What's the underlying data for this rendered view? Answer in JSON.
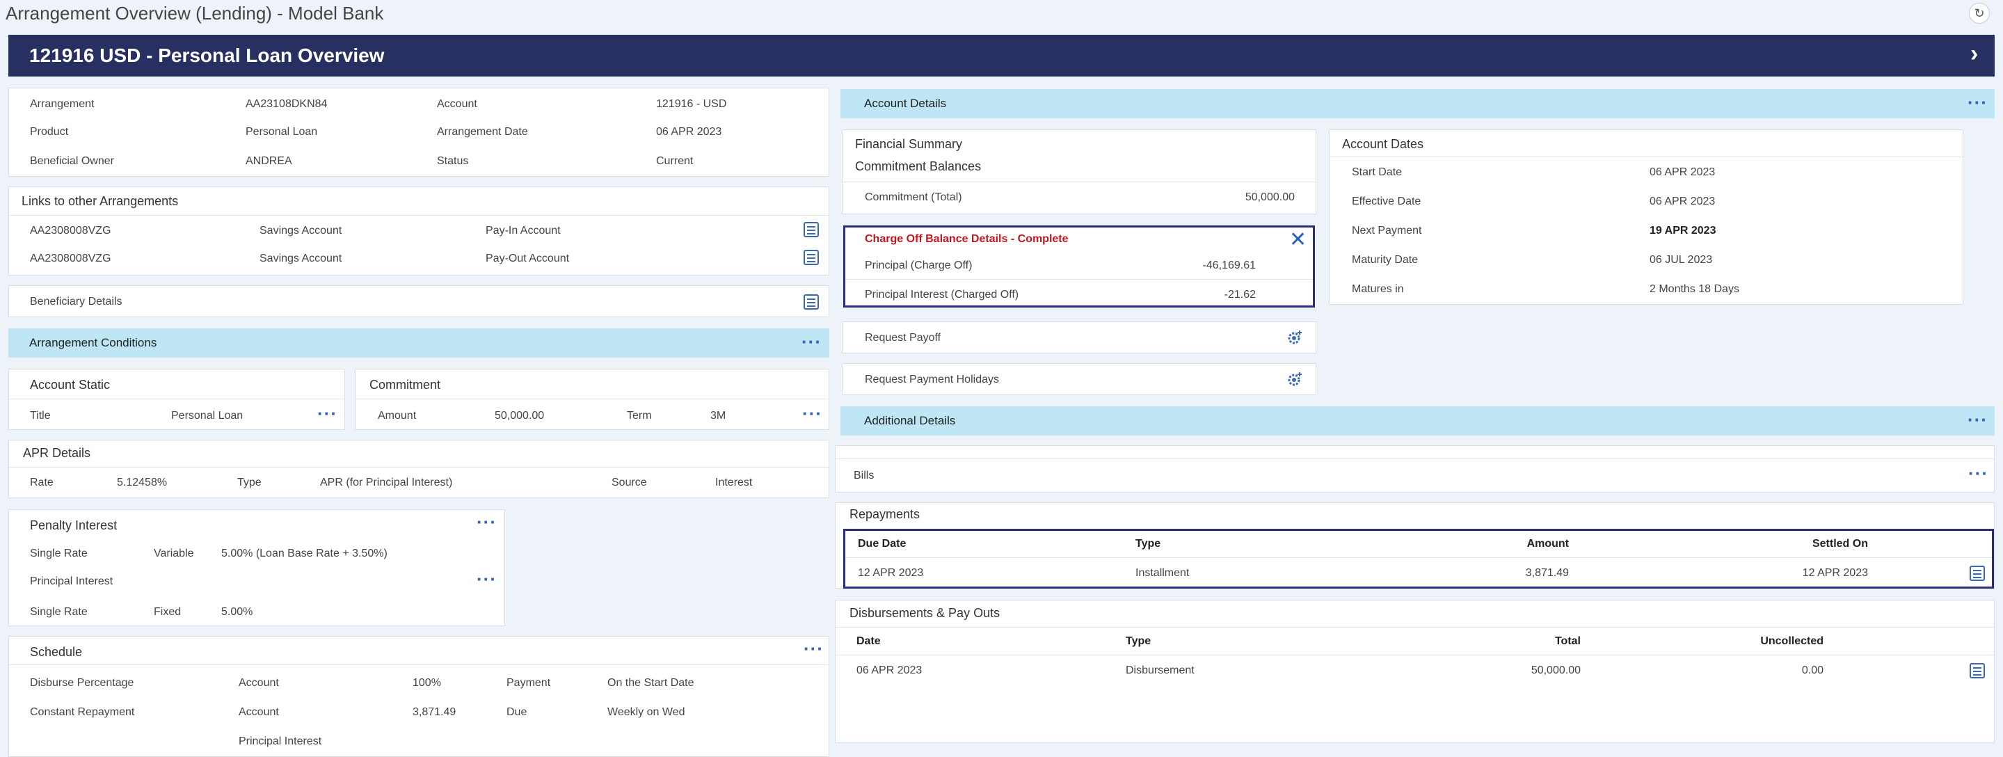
{
  "window": {
    "title": "Arrangement Overview (Lending) - Model Bank"
  },
  "banner": {
    "title": "121916 USD - Personal Loan Overview"
  },
  "arrangement": {
    "arrangement_label": "Arrangement",
    "arrangement_value": "AA23108DKN84",
    "account_label": "Account",
    "account_value": "121916 - USD",
    "product_label": "Product",
    "product_value": "Personal Loan",
    "arr_date_label": "Arrangement Date",
    "arr_date_value": "06 APR 2023",
    "owner_label": "Beneficial Owner",
    "owner_value": "ANDREA",
    "status_label": "Status",
    "status_value": "Current"
  },
  "links": {
    "title": "Links to other Arrangements",
    "rows": [
      {
        "id": "AA2308008VZG",
        "type": "Savings Account",
        "role": "Pay-In Account"
      },
      {
        "id": "AA2308008VZG",
        "type": "Savings Account",
        "role": "Pay-Out Account"
      }
    ]
  },
  "beneficiary": {
    "title": "Beneficiary Details"
  },
  "conditions": {
    "title": "Arrangement Conditions"
  },
  "account_static": {
    "title": "Account Static",
    "label": "Title",
    "value": "Personal Loan"
  },
  "commitment": {
    "title": "Commitment",
    "amount_label": "Amount",
    "amount_value": "50,000.00",
    "term_label": "Term",
    "term_value": "3M"
  },
  "apr": {
    "title": "APR Details",
    "rate_label": "Rate",
    "rate_value": "5.12458%",
    "type_label": "Type",
    "type_value": "APR (for Principal Interest)",
    "source_label": "Source",
    "source_value": "Interest"
  },
  "penalty": {
    "title": "Penalty Interest",
    "rate_label": "Single Rate",
    "rate_kind": "Variable",
    "rate_value": "5.00% (Loan Base Rate + 3.50%)",
    "principal_title": "Principal Interest",
    "p_rate_label": "Single Rate",
    "p_rate_kind": "Fixed",
    "p_rate_value": "5.00%"
  },
  "schedule": {
    "title": "Schedule",
    "r1": {
      "a": "Disburse Percentage",
      "b": "Account",
      "c": "100%",
      "d": "Payment",
      "e": "On the Start Date"
    },
    "r2": {
      "a": "Constant Repayment",
      "b": "Account",
      "c": "3,871.49",
      "d": "Due",
      "e": "Weekly on Wed"
    },
    "r3": {
      "b": "Principal Interest"
    }
  },
  "account_details": {
    "title": "Account Details"
  },
  "financial": {
    "title": "Financial Summary",
    "subtitle": "Commitment Balances",
    "commit_label": "Commitment (Total)",
    "commit_value": "50,000.00"
  },
  "chargeoff": {
    "title": "Charge Off Balance Details - Complete",
    "p_label": "Principal (Charge Off)",
    "p_value": "-46,169.61",
    "i_label": "Principal Interest (Charged Off)",
    "i_value": "-21.62"
  },
  "payoff": {
    "label": "Request Payoff"
  },
  "holidays": {
    "label": "Request Payment Holidays"
  },
  "dates": {
    "title": "Account Dates",
    "rows": [
      {
        "label": "Start Date",
        "value": "06 APR 2023"
      },
      {
        "label": "Effective Date",
        "value": "06 APR 2023"
      },
      {
        "label": "Next Payment",
        "value": "19 APR 2023"
      },
      {
        "label": "Maturity Date",
        "value": "06 JUL 2023"
      },
      {
        "label": "Matures in",
        "value": "2 Months 18 Days"
      }
    ]
  },
  "additional": {
    "title": "Additional Details"
  },
  "bills": {
    "title": "Bills"
  },
  "repayments": {
    "title": "Repayments",
    "h_due": "Due Date",
    "h_type": "Type",
    "h_amount": "Amount",
    "h_settled": "Settled On",
    "due": "12 APR 2023",
    "type": "Installment",
    "amount": "3,871.49",
    "settled": "12 APR 2023"
  },
  "disbursements": {
    "title": "Disbursements & Pay Outs",
    "h_date": "Date",
    "h_type": "Type",
    "h_total": "Total",
    "h_uncollected": "Uncollected",
    "date": "06 APR 2023",
    "type": "Disbursement",
    "total": "50,000.00",
    "uncollected": "0.00"
  }
}
